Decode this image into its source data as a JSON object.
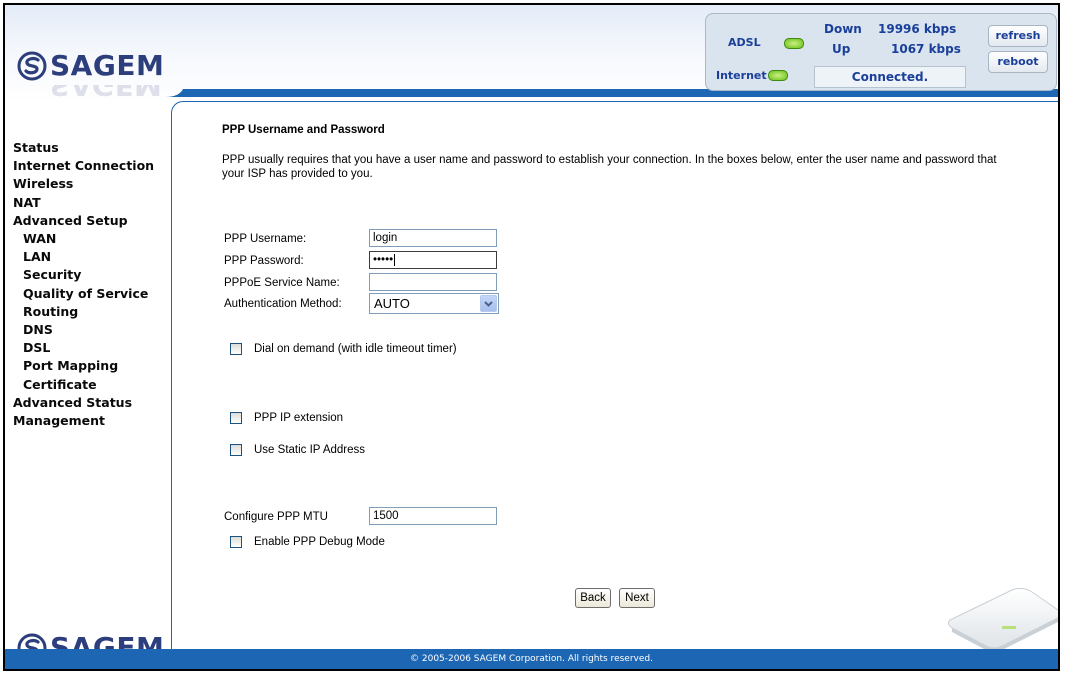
{
  "brand": {
    "logo_text": "SAGEM"
  },
  "status": {
    "adsl_label": "ADSL",
    "internet_label": "Internet",
    "down_label": "Down",
    "down_value": "19996 kbps",
    "up_label": "Up",
    "up_value": "1067 kbps",
    "connection": "Connected.",
    "refresh_label": "refresh",
    "reboot_label": "reboot",
    "led_color": "#6cbf1a"
  },
  "sidebar": {
    "items": [
      {
        "label": "Status",
        "level": 0
      },
      {
        "label": "Internet Connection",
        "level": 0
      },
      {
        "label": "Wireless",
        "level": 0
      },
      {
        "label": "NAT",
        "level": 0
      },
      {
        "label": "Advanced Setup",
        "level": 0
      },
      {
        "label": "WAN",
        "level": 1
      },
      {
        "label": "LAN",
        "level": 1
      },
      {
        "label": "Security",
        "level": 1
      },
      {
        "label": "Quality of Service",
        "level": 1
      },
      {
        "label": "Routing",
        "level": 1
      },
      {
        "label": "DNS",
        "level": 1
      },
      {
        "label": "DSL",
        "level": 1
      },
      {
        "label": "Port Mapping",
        "level": 1
      },
      {
        "label": "Certificate",
        "level": 1
      },
      {
        "label": "Advanced Status",
        "level": 0
      },
      {
        "label": "Management",
        "level": 0
      }
    ]
  },
  "main": {
    "title": "PPP Username and Password",
    "description": "PPP usually requires that you have a user name and password to establish your connection. In the boxes below, enter the user name and password that your ISP has provided to you.",
    "username_label": "PPP Username:",
    "username_value": "login",
    "password_label": "PPP Password:",
    "password_value": "•••••",
    "service_label": "PPPoE Service Name:",
    "service_value": "",
    "auth_label": "Authentication Method:",
    "auth_value": "AUTO",
    "dial_on_demand_label": "Dial on demand (with idle timeout timer)",
    "ip_extension_label": "PPP IP extension",
    "static_ip_label": "Use Static IP Address",
    "mtu_label": "Configure PPP MTU",
    "mtu_value": "1500",
    "debug_label": "Enable PPP Debug Mode",
    "back_label": "Back",
    "next_label": "Next"
  },
  "footer": {
    "copyright": "© 2005-2006 SAGEM Corporation. All rights reserved."
  },
  "colors": {
    "accent": "#1d66b3",
    "brand_navy": "#2d3e7c",
    "status_text": "#1a3f9a"
  }
}
